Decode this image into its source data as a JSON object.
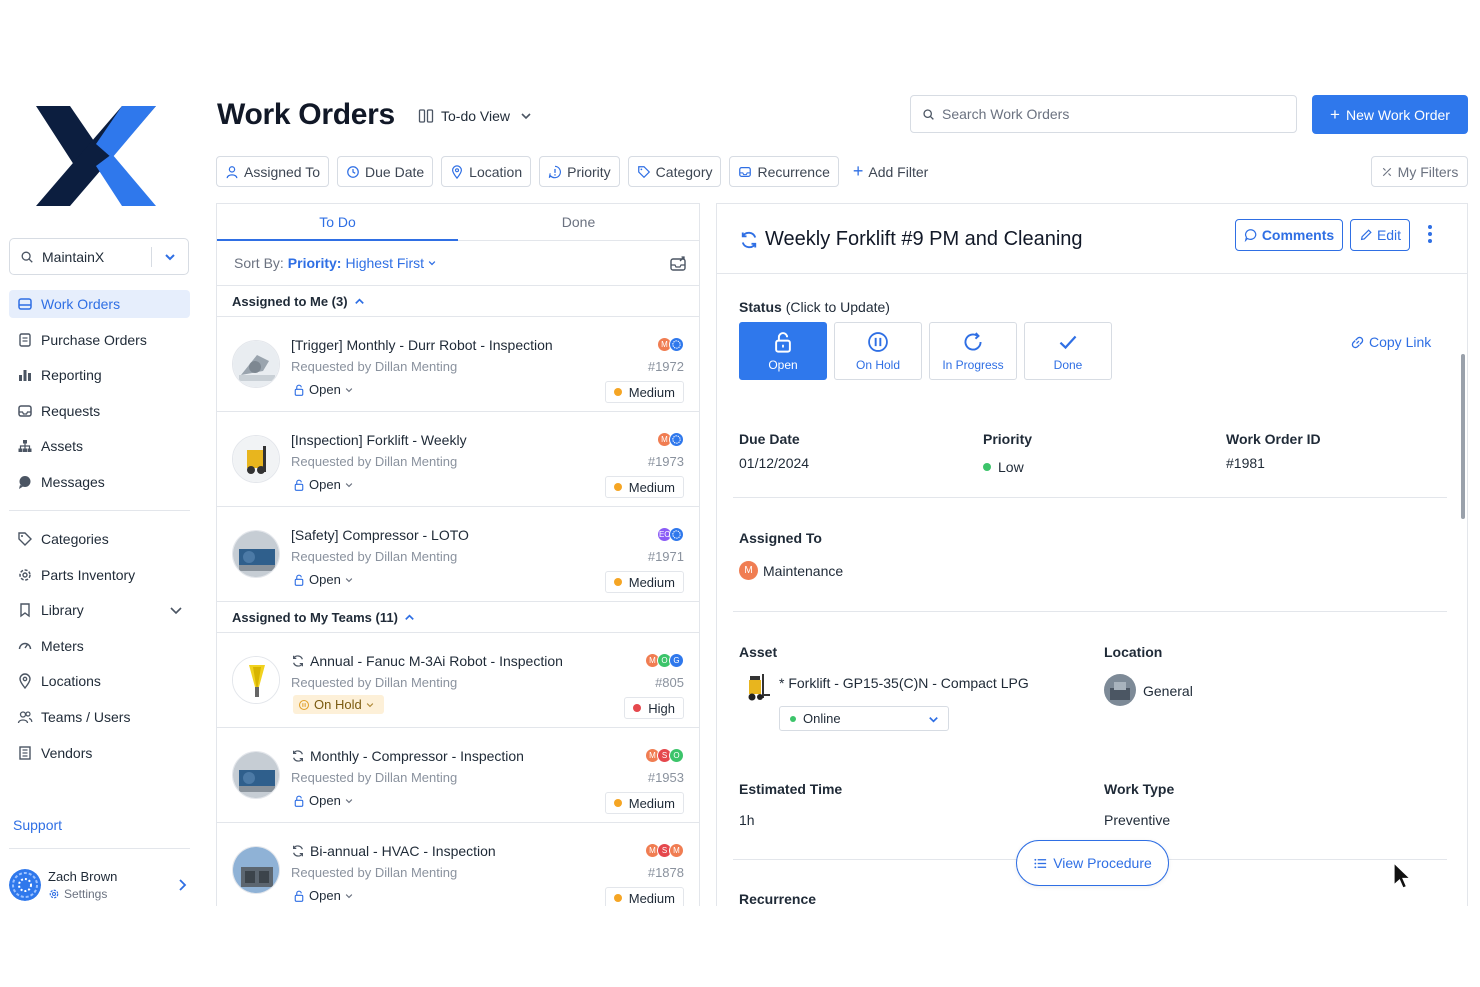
{
  "sidebar": {
    "org": "MaintainX",
    "nav_main": [
      {
        "label": "Work Orders",
        "icon": "work-orders-icon"
      },
      {
        "label": "Purchase Orders",
        "icon": "document-icon"
      },
      {
        "label": "Reporting",
        "icon": "bar-chart-icon"
      },
      {
        "label": "Requests",
        "icon": "inbox-icon"
      },
      {
        "label": "Assets",
        "icon": "hierarchy-icon"
      },
      {
        "label": "Messages",
        "icon": "chat-icon"
      }
    ],
    "nav_secondary": [
      {
        "label": "Categories",
        "icon": "tag-icon"
      },
      {
        "label": "Parts Inventory",
        "icon": "gear-icon"
      },
      {
        "label": "Library",
        "icon": "bookmark-icon"
      },
      {
        "label": "Meters",
        "icon": "gauge-icon"
      },
      {
        "label": "Locations",
        "icon": "pin-icon"
      },
      {
        "label": "Teams / Users",
        "icon": "users-icon"
      },
      {
        "label": "Vendors",
        "icon": "vendor-icon"
      }
    ],
    "support": "Support",
    "user": {
      "name": "Zach Brown",
      "settings": "Settings"
    }
  },
  "header": {
    "title": "Work Orders",
    "view": "To-do View",
    "search_placeholder": "Search Work Orders",
    "new_button": "New Work Order"
  },
  "filters": {
    "items": [
      "Assigned To",
      "Due Date",
      "Location",
      "Priority",
      "Category",
      "Recurrence"
    ],
    "add": "Add Filter",
    "my_filters": "My Filters"
  },
  "list": {
    "tabs": [
      "To Do",
      "Done"
    ],
    "sort_prefix": "Sort By:",
    "sort_field": "Priority:",
    "sort_value": "Highest First",
    "groups": [
      {
        "title": "Assigned to Me (3)",
        "items": [
          {
            "title": "[Trigger] Monthly - Durr Robot - Inspection",
            "requested": "Requested by Dillan Menting",
            "status": "Open",
            "id": "#1972",
            "priority": "Medium",
            "recurring": false,
            "avatars": [
              "M",
              ""
            ]
          },
          {
            "title": "[Inspection] Forklift - Weekly",
            "requested": "Requested by Dillan Menting",
            "status": "Open",
            "id": "#1973",
            "priority": "Medium",
            "recurring": false,
            "avatars": [
              "M",
              ""
            ]
          },
          {
            "title": "[Safety] Compressor - LOTO",
            "requested": "Requested by Dillan Menting",
            "status": "Open",
            "id": "#1971",
            "priority": "Medium",
            "recurring": false,
            "avatars": [
              "EC",
              ""
            ]
          }
        ]
      },
      {
        "title": "Assigned to My Teams (11)",
        "items": [
          {
            "title": "Annual - Fanuc M-3Ai Robot - Inspection",
            "requested": "Requested by Dillan Menting",
            "status": "On Hold",
            "id": "#805",
            "priority": "High",
            "recurring": true,
            "avatars": [
              "M",
              "O",
              "G"
            ]
          },
          {
            "title": "Monthly - Compressor - Inspection",
            "requested": "Requested by Dillan Menting",
            "status": "Open",
            "id": "#1953",
            "priority": "Medium",
            "recurring": true,
            "avatars": [
              "M",
              "S",
              "O"
            ]
          },
          {
            "title": "Bi-annual - HVAC - Inspection",
            "requested": "Requested by Dillan Menting",
            "status": "Open",
            "id": "#1878",
            "priority": "Medium",
            "recurring": true,
            "avatars": [
              "M",
              "S",
              "M"
            ]
          }
        ]
      }
    ]
  },
  "detail": {
    "title": "Weekly Forklift #9 PM and Cleaning",
    "comments": "Comments",
    "edit": "Edit",
    "status_label": "Status",
    "status_hint": "(Click to Update)",
    "statuses": [
      "Open",
      "On Hold",
      "In Progress",
      "Done"
    ],
    "copy_link": "Copy Link",
    "due_date_label": "Due Date",
    "due_date": "01/12/2024",
    "priority_label": "Priority",
    "priority": "Low",
    "wo_id_label": "Work Order ID",
    "wo_id": "#1981",
    "assigned_label": "Assigned To",
    "assigned_avatar": "M",
    "assigned": "Maintenance",
    "asset_label": "Asset",
    "asset": "* Forklift - GP15-35(C)N - Compact LPG",
    "asset_status": "Online",
    "location_label": "Location",
    "location": "General",
    "est_time_label": "Estimated Time",
    "est_time": "1h",
    "work_type_label": "Work Type",
    "work_type": "Preventive",
    "recurrence_label": "Recurrence",
    "view_procedure": "View Procedure"
  },
  "colors": {
    "accent": "#2f78ec",
    "medium": "#f5a524",
    "high": "#e5484d",
    "low": "#3cc46a"
  }
}
